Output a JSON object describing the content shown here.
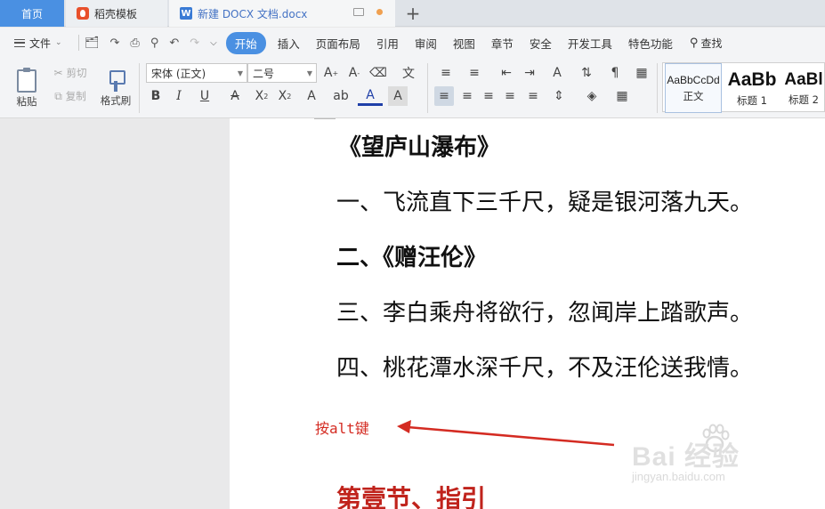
{
  "tabs": {
    "home": "首页",
    "template": "稻壳模板",
    "document": "新建 DOCX 文档.docx",
    "add": "+"
  },
  "menu": {
    "file": "文件",
    "items": [
      "开始",
      "插入",
      "页面布局",
      "引用",
      "审阅",
      "视图",
      "章节",
      "安全",
      "开发工具",
      "特色功能"
    ],
    "search": "查找"
  },
  "ribbon": {
    "paste": "粘贴",
    "cut": "剪切",
    "copy": "复制",
    "format_painter": "格式刷",
    "font_name": "宋体 (正文)",
    "font_size": "二号",
    "styles": [
      {
        "sample": "AaBbCcDd",
        "label": "正文"
      },
      {
        "sample": "AaBb",
        "label": "标题 1"
      },
      {
        "sample": "AaBl",
        "label": "标题 2"
      }
    ]
  },
  "document": {
    "lines": [
      "《望庐山瀑布》",
      "一、飞流直下三千尺，疑是银河落九天。",
      "二、《赠汪伦》",
      "三、李白乘舟将欲行，忽闻岸上踏歌声。",
      "四、桃花潭水深千尺，不及汪伦送我情。"
    ],
    "heading": "第壹节、指引"
  },
  "annotation": {
    "text": "按alt键"
  },
  "watermark": {
    "brand": "Bai  经验",
    "url": "jingyan.baidu.com"
  },
  "colors": {
    "accent": "#4a90e2",
    "annotation": "#d42b22",
    "heading": "#c0231c"
  }
}
